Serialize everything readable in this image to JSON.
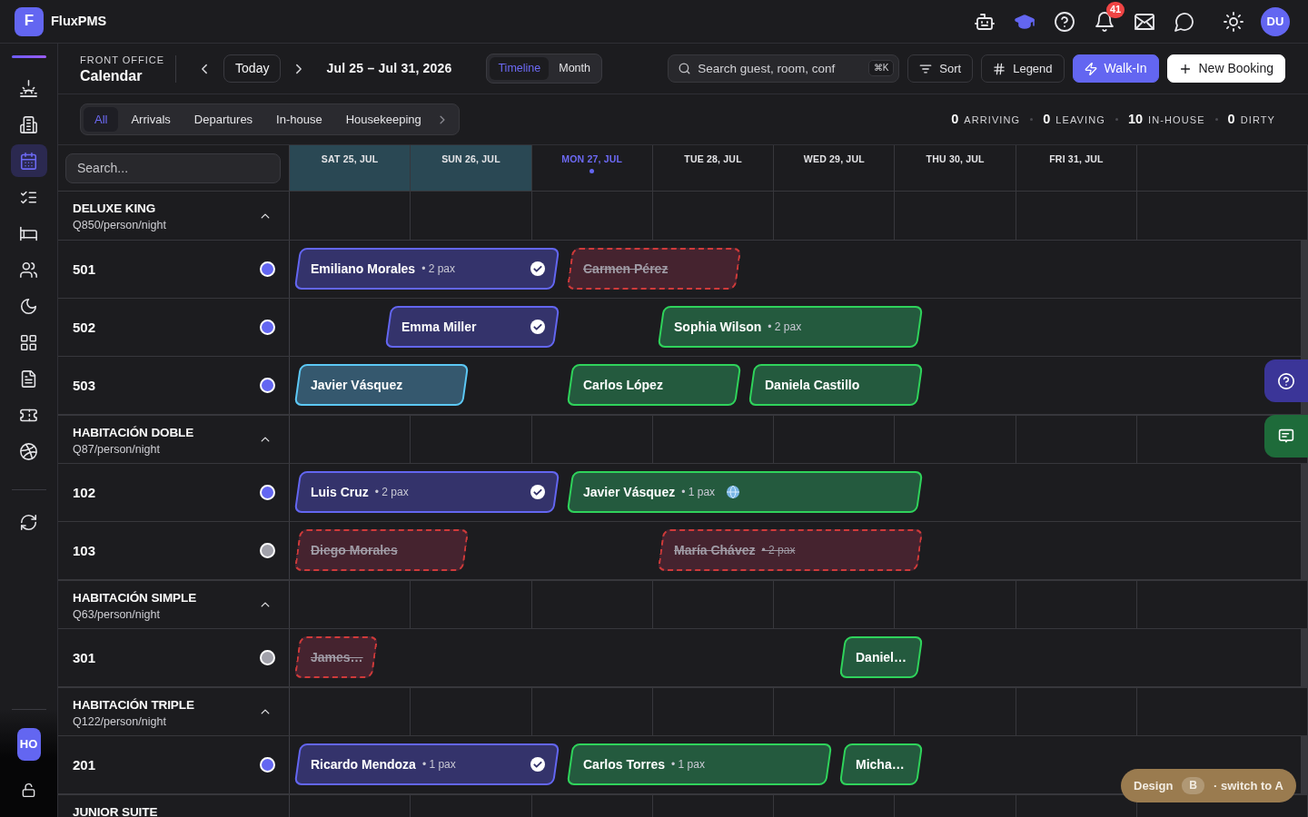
{
  "app": {
    "logo_letter": "F",
    "name": "FluxPMS",
    "notification_count": "41",
    "user_initials": "DU"
  },
  "sidebar": {
    "groups": [
      {
        "items": [
          {
            "selected": false
          },
          {
            "selected": false
          },
          {
            "selected": true
          },
          {
            "selected": false
          },
          {
            "selected": false
          },
          {
            "selected": false
          },
          {
            "selected": false
          },
          {
            "selected": false
          },
          {
            "selected": false
          },
          {
            "selected": false
          },
          {
            "selected": false
          }
        ]
      },
      {
        "items": [
          {
            "selected": false
          }
        ]
      }
    ],
    "workspace_initials": "HO"
  },
  "header": {
    "section": "FRONT OFFICE",
    "title": "Calendar",
    "today_button": "Today",
    "date_range": "Jul 25 – Jul 31, 2026",
    "views": [
      {
        "label": "Timeline",
        "selected": true
      },
      {
        "label": "Month",
        "selected": false
      }
    ],
    "search": {
      "placeholder": "Search guest, room, conf",
      "shortcut": "⌘K"
    },
    "buttons": [
      {
        "label": "Sort",
        "kind": "sort"
      },
      {
        "label": "Legend",
        "kind": "legend"
      },
      {
        "label": "Walk-In",
        "kind": "walk_in"
      },
      {
        "label": "New Booking",
        "kind": "new_booking"
      }
    ]
  },
  "filters": [
    {
      "label": "All",
      "selected": true
    },
    {
      "label": "Arrivals",
      "selected": false
    },
    {
      "label": "Departures",
      "selected": false
    },
    {
      "label": "In-house",
      "selected": false
    },
    {
      "label": "Housekeeping",
      "selected": false
    }
  ],
  "stats": [
    {
      "value": "0",
      "label": "ARRIVING"
    },
    {
      "value": "0",
      "label": "LEAVING"
    },
    {
      "value": "10",
      "label": "IN-HOUSE"
    },
    {
      "value": "0",
      "label": "DIRTY"
    }
  ],
  "timeline": {
    "search": {
      "placeholder": "Search..."
    },
    "days": [
      {
        "label": "SAT 25, JUL",
        "weekend": true,
        "today": false
      },
      {
        "label": "SUN 26, JUL",
        "weekend": true,
        "today": false
      },
      {
        "label": "MON 27, JUL",
        "weekend": false,
        "today": true
      },
      {
        "label": "TUE 28, JUL",
        "weekend": false,
        "today": false
      },
      {
        "label": "WED 29, JUL",
        "weekend": false,
        "today": false
      },
      {
        "label": "THU 30, JUL",
        "weekend": false,
        "today": false
      },
      {
        "label": "FRI 31, JUL",
        "weekend": false,
        "today": false
      }
    ],
    "groups": [
      {
        "name": "DELUXE KING",
        "rate": "Q850/person/night",
        "expanded": true,
        "rooms": [
          {
            "number": "501",
            "color": "#6366f1",
            "bookings": [
              {
                "guest": "Emiliano Morales",
                "pax": "• 2 pax",
                "kind": "checked_in",
                "web": false
              },
              {
                "guest": "Carmen Pérez",
                "kind": "cancelled",
                "web": false
              }
            ]
          },
          {
            "number": "502",
            "color": "#6366f1",
            "bookings": [
              {
                "guest": "Emma Miller",
                "kind": "checked_in",
                "web": false
              },
              {
                "guest": "Sophia Wilson",
                "pax": "• 2 pax",
                "kind": "confirmed",
                "web": false
              }
            ]
          },
          {
            "number": "503",
            "color": "#6366f1",
            "bookings": [
              {
                "guest": "Javier Vásquez",
                "kind": "tentative",
                "web": false
              },
              {
                "guest": "Carlos López",
                "kind": "confirmed",
                "web": false
              },
              {
                "guest": "Daniela Castillo",
                "kind": "confirmed",
                "web": false
              }
            ]
          }
        ]
      },
      {
        "name": "HABITACIÓN DOBLE",
        "rate": "Q87/person/night",
        "expanded": true,
        "rooms": [
          {
            "number": "102",
            "color": "#6366f1",
            "bookings": [
              {
                "guest": "Luis Cruz",
                "pax": "• 2 pax",
                "kind": "checked_in",
                "web": false
              },
              {
                "guest": "Javier Vásquez",
                "pax": "• 1 pax",
                "kind": "confirmed",
                "web": true
              }
            ]
          },
          {
            "number": "103",
            "color": "#a1a1aa",
            "bookings": [
              {
                "guest": "Diego Morales",
                "kind": "cancelled",
                "web": false
              },
              {
                "guest": "María Chávez",
                "pax": "• 2 pax",
                "kind": "cancelled",
                "web": false
              }
            ]
          }
        ]
      },
      {
        "name": "HABITACIÓN SIMPLE",
        "rate": "Q63/person/night",
        "expanded": true,
        "rooms": [
          {
            "number": "301",
            "color": "#a1a1aa",
            "bookings": [
              {
                "guest": "James…",
                "kind": "cancelled",
                "web": false
              },
              {
                "guest": "Daniel…",
                "kind": "confirmed",
                "web": false
              }
            ]
          }
        ]
      },
      {
        "name": "HABITACIÓN TRIPLE",
        "rate": "Q122/person/night",
        "expanded": true,
        "rooms": [
          {
            "number": "201",
            "color": "#6366f1",
            "bookings": [
              {
                "guest": "Ricardo Mendoza",
                "pax": "• 1 pax",
                "kind": "checked_in",
                "web": false
              },
              {
                "guest": "Carlos Torres",
                "pax": "• 1 pax",
                "kind": "confirmed",
                "web": false
              },
              {
                "guest": "Micha…",
                "kind": "confirmed",
                "web": false
              }
            ]
          }
        ]
      },
      {
        "name": "JUNIOR SUITE"
      }
    ]
  },
  "design_switch": {
    "label": "Design",
    "variant": "B",
    "action": "· switch to A"
  }
}
